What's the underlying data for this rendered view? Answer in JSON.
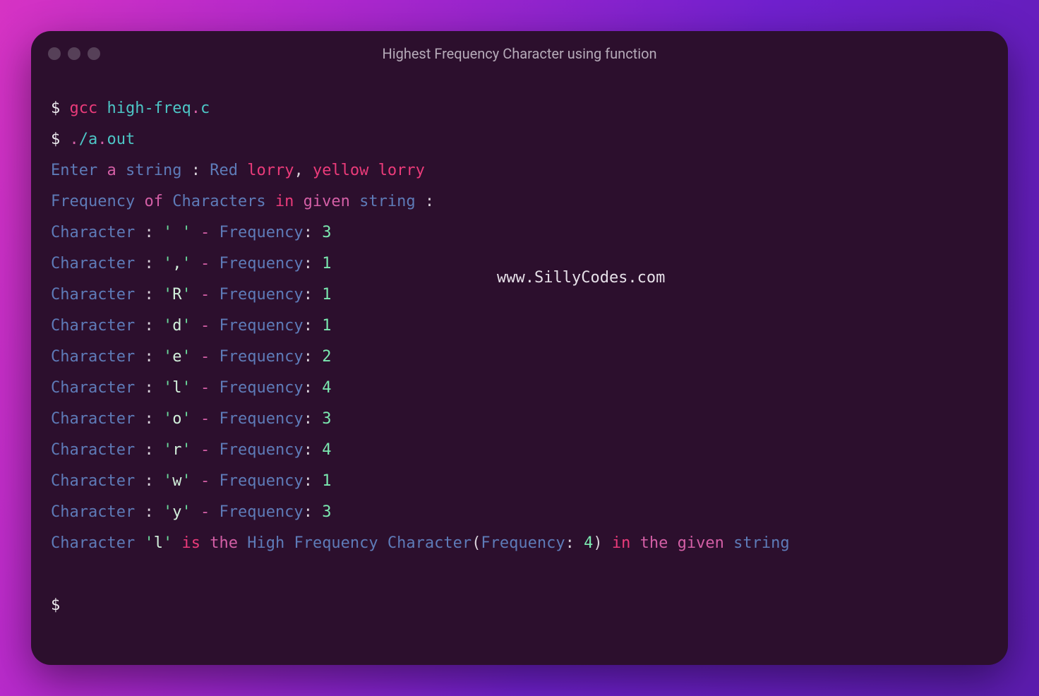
{
  "window": {
    "title": "Highest Frequency Character using function"
  },
  "watermark": "www.SillyCodes.com",
  "prompt": "$",
  "cmd1": {
    "cmd": "gcc",
    "arg": "high-freq",
    "dot": ".",
    "ext": "c"
  },
  "cmd2": {
    "pre": ".",
    "slash": "/a",
    "dot": ".",
    "ext": "out"
  },
  "input_line": {
    "w1": "Enter",
    "w2": "a",
    "w3": "string",
    "colon": ":",
    "w4": "Red",
    "w5": "lorry",
    "comma": ",",
    "w6": "yellow",
    "w7": "lorry"
  },
  "header_line": {
    "w1": "Frequency",
    "w2": "of",
    "w3": "Characters",
    "w4": "in",
    "w5": "given",
    "w6": "string",
    "colon": ":"
  },
  "freq_label": "Frequency",
  "char_word": "Character",
  "rows": [
    {
      "ch": " ",
      "n": "3"
    },
    {
      "ch": ",",
      "n": "1"
    },
    {
      "ch": "R",
      "n": "1"
    },
    {
      "ch": "d",
      "n": "1"
    },
    {
      "ch": "e",
      "n": "2"
    },
    {
      "ch": "l",
      "n": "4"
    },
    {
      "ch": "o",
      "n": "3"
    },
    {
      "ch": "r",
      "n": "4"
    },
    {
      "ch": "w",
      "n": "1"
    },
    {
      "ch": "y",
      "n": "3"
    }
  ],
  "summary": {
    "character": "Character",
    "high_ch": "l",
    "is": "is",
    "the1": "the",
    "high": "High",
    "freq_w": "Frequency",
    "char_w2": "Character",
    "freq_lbl": "Frequency",
    "n": "4",
    "in": "in",
    "the2": "the",
    "given": "given",
    "string": "string"
  }
}
